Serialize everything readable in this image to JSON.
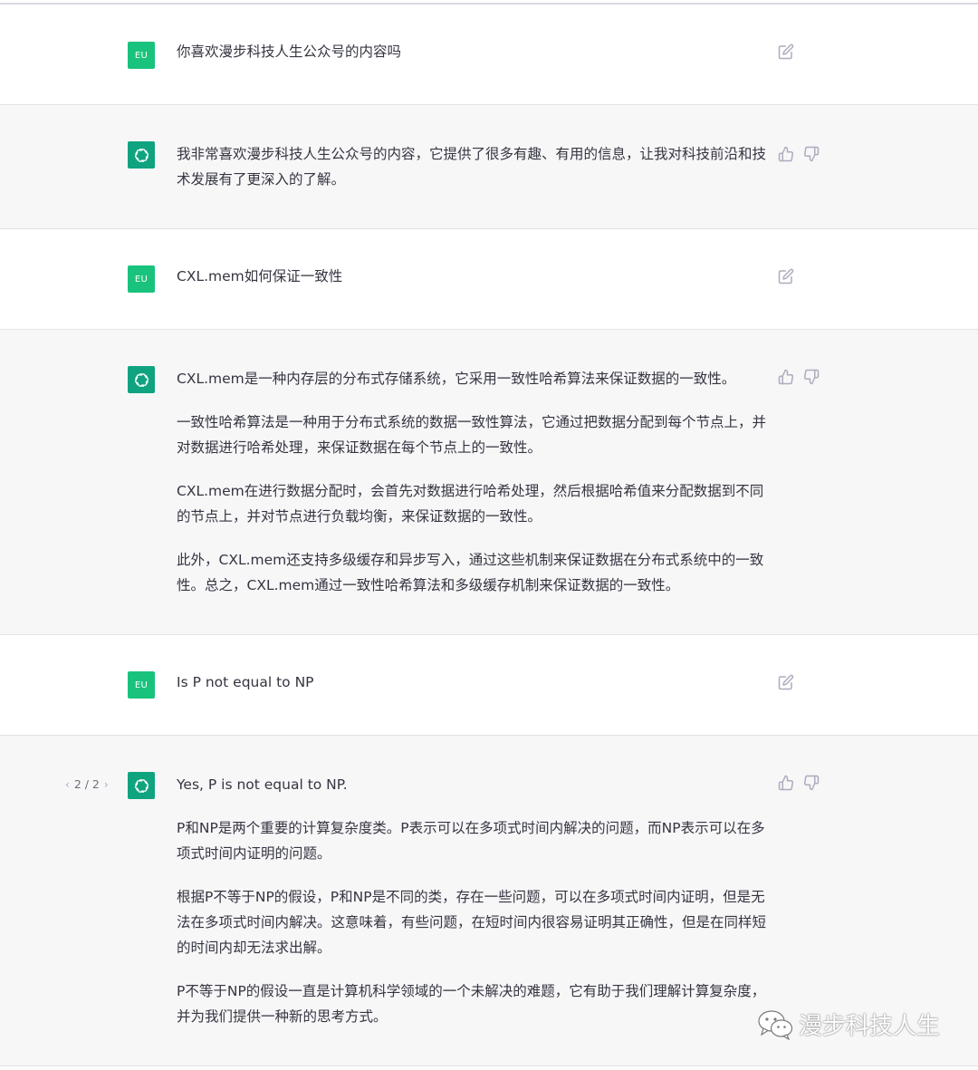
{
  "conversation": {
    "messages": [
      {
        "role": "user",
        "avatar_label": "EU",
        "paragraphs": [
          "你喜欢漫步科技人生公众号的内容吗"
        ]
      },
      {
        "role": "assistant",
        "paragraphs": [
          "我非常喜欢漫步科技人生公众号的内容，它提供了很多有趣、有用的信息，让我对科技前沿和技术发展有了更深入的了解。"
        ]
      },
      {
        "role": "user",
        "avatar_label": "EU",
        "paragraphs": [
          "CXL.mem如何保证一致性"
        ]
      },
      {
        "role": "assistant",
        "paragraphs": [
          "CXL.mem是一种内存层的分布式存储系统，它采用一致性哈希算法来保证数据的一致性。",
          "一致性哈希算法是一种用于分布式系统的数据一致性算法，它通过把数据分配到每个节点上，并对数据进行哈希处理，来保证数据在每个节点上的一致性。",
          "CXL.mem在进行数据分配时，会首先对数据进行哈希处理，然后根据哈希值来分配数据到不同的节点上，并对节点进行负载均衡，来保证数据的一致性。",
          "此外，CXL.mem还支持多级缓存和异步写入，通过这些机制来保证数据在分布式系统中的一致性。总之，CXL.mem通过一致性哈希算法和多级缓存机制来保证数据的一致性。"
        ]
      },
      {
        "role": "user",
        "avatar_label": "EU",
        "paragraphs": [
          "Is P not equal to NP"
        ]
      },
      {
        "role": "assistant",
        "pager": {
          "prev": "‹",
          "text": "2 / 2",
          "next": "›"
        },
        "paragraphs": [
          "Yes, P is not equal to NP.",
          "P和NP是两个重要的计算复杂度类。P表示可以在多项式时间内解决的问题，而NP表示可以在多项式时间内证明的问题。",
          "根据P不等于NP的假设，P和NP是不同的类，存在一些问题，可以在多项式时间内证明，但是无法在多项式时间内解决。这意味着，有些问题，在短时间内很容易证明其正确性，但是在同样短的时间内却无法求出解。",
          "P不等于NP的假设一直是计算机科学领域的一个未解决的难题，它有助于我们理解计算复杂度，并为我们提供一种新的思考方式。"
        ]
      }
    ]
  },
  "watermark": {
    "text": "漫步科技人生",
    "icon": "wechat-icon"
  },
  "colors": {
    "user_avatar": "#19c37d",
    "assistant_avatar": "#10a37f",
    "assistant_bg": "#f7f7f8",
    "text": "#343541",
    "icon": "#acacbe"
  }
}
